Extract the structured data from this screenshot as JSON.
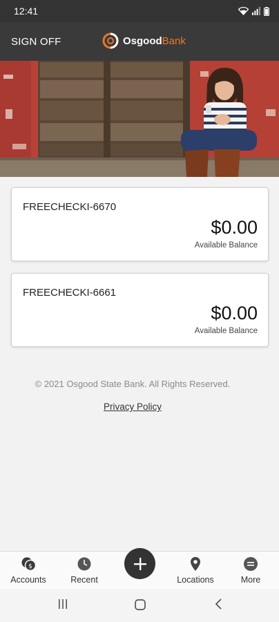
{
  "status_bar": {
    "time": "12:41"
  },
  "header": {
    "sign_off_label": "SIGN OFF",
    "logo_name": "Osgood",
    "logo_bank": "Bank",
    "brand_color": "#e8782a"
  },
  "accounts": [
    {
      "name": "FREECHECKI-6670",
      "balance": "$0.00",
      "balance_label": "Available Balance"
    },
    {
      "name": "FREECHECKI-6661",
      "balance": "$0.00",
      "balance_label": "Available Balance"
    }
  ],
  "footer": {
    "copyright": "© 2021 Osgood State Bank. All Rights Reserved.",
    "privacy_link": "Privacy Policy"
  },
  "tab_bar": {
    "tabs": [
      {
        "label": "Accounts",
        "icon": "accounts-icon"
      },
      {
        "label": "Recent",
        "icon": "clock-icon"
      },
      {
        "label": "Locations",
        "icon": "location-pin-icon"
      },
      {
        "label": "More",
        "icon": "more-icon"
      }
    ],
    "add_icon": "plus-icon"
  },
  "nav_bar": {
    "buttons": [
      "recent-apps-icon",
      "home-icon",
      "back-icon"
    ]
  }
}
